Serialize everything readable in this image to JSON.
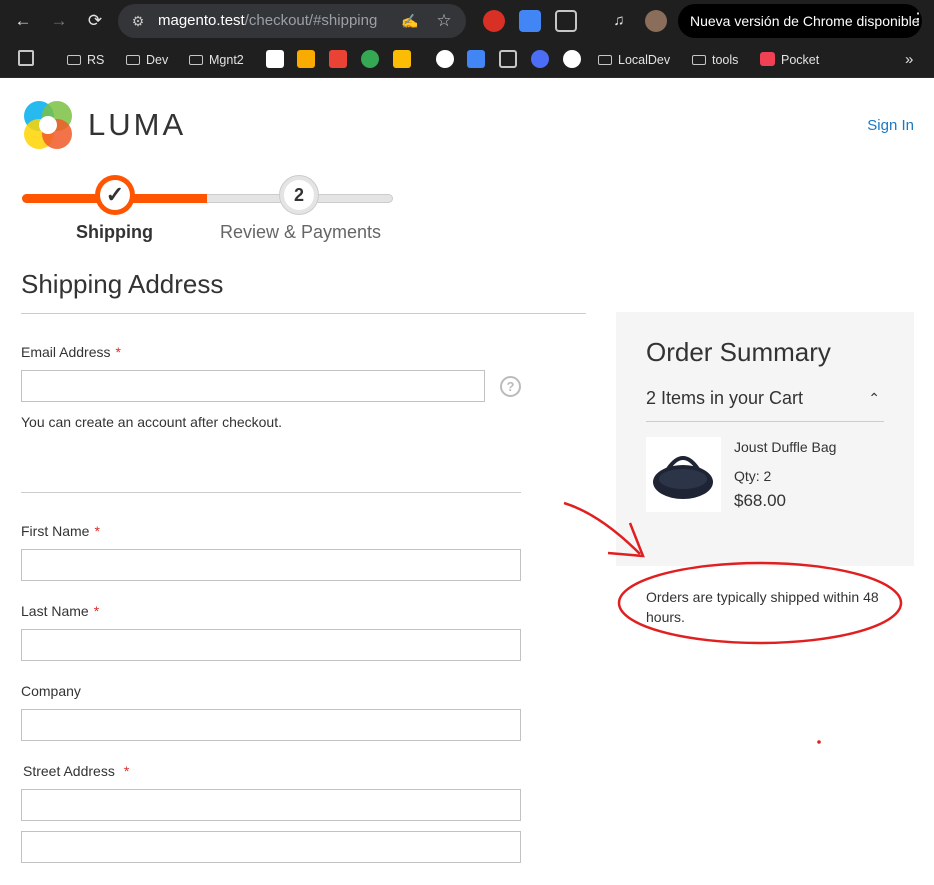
{
  "browser": {
    "url_host": "magento.test",
    "url_path": "/checkout/#shipping",
    "update_text": "Nueva versión de Chrome disponible",
    "bookmarks": [
      "RS",
      "Dev",
      "Mgnt2",
      "LocalDev",
      "tools",
      "Pocket"
    ]
  },
  "header": {
    "logo_text": "LUMA",
    "sign_in": "Sign In"
  },
  "progress": {
    "step1_label": "Shipping",
    "step2_number": "2",
    "step2_label": "Review & Payments"
  },
  "shipping": {
    "title": "Shipping Address",
    "email_label": "Email Address",
    "email_note": "You can create an account after checkout.",
    "first_name_label": "First Name",
    "last_name_label": "Last Name",
    "company_label": "Company",
    "street_label": "Street Address",
    "required_mark": "*"
  },
  "summary": {
    "title": "Order Summary",
    "items_count": "2 Items in your Cart",
    "product_name": "Joust Duffle Bag",
    "product_qty": "Qty: 2",
    "product_price": "$68.00",
    "shipping_note": "Orders are typically shipped within 48 hours."
  },
  "colors": {
    "accent_orange": "#ff5501",
    "link_blue": "#1979c3",
    "required_red": "#e02b27",
    "annotation_red": "#e02020"
  }
}
